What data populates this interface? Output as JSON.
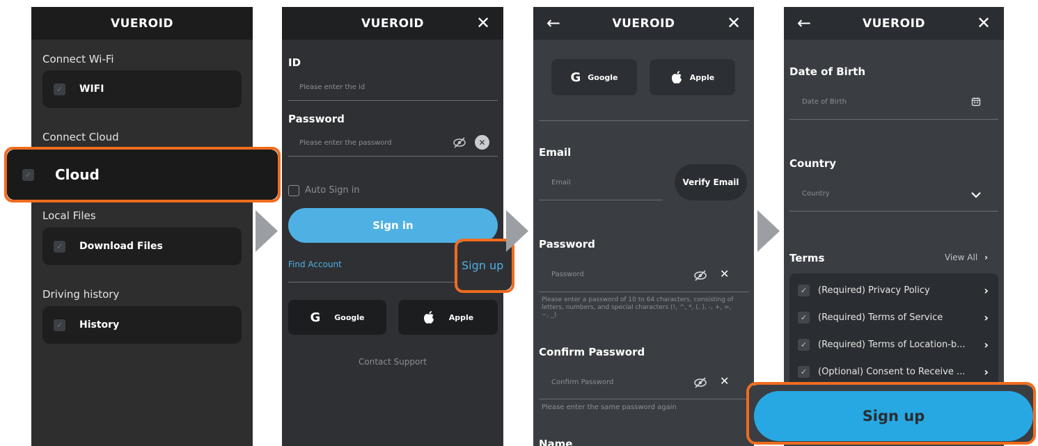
{
  "app": {
    "title": "VUEROID"
  },
  "screen1": {
    "sections": [
      {
        "label": "Connect Wi-Fi",
        "item": "WIFI"
      },
      {
        "label": "Connect Cloud",
        "item": "Cloud"
      },
      {
        "label": "Local Files",
        "item": "Download Files"
      },
      {
        "label": "Driving history",
        "item": "History"
      }
    ]
  },
  "screen2": {
    "id_label": "ID",
    "id_placeholder": "Please enter the id",
    "password_label": "Password",
    "password_placeholder": "Please enter the password",
    "auto_signin": "Auto Sign in",
    "signin_button": "Sign in",
    "find_account": "Find Account",
    "signup_link": "Sign up",
    "google": "Google",
    "apple": "Apple",
    "contact": "Contact Support"
  },
  "screen3": {
    "google": "Google",
    "apple": "Apple",
    "email_label": "Email",
    "email_placeholder": "Email",
    "verify_button": "Verify Email",
    "password_label": "Password",
    "password_placeholder": "Password",
    "password_hint": "Please enter a password of 10 to 64 characters, consisting of letters, numbers, and special characters (!, ^, *, (, ), -, +, =, ~, _)",
    "confirm_label": "Confirm Password",
    "confirm_placeholder": "Confirm Password",
    "confirm_hint": "Please enter the same password again",
    "name_label": "Name"
  },
  "screen4": {
    "dob_label": "Date of Birth",
    "dob_placeholder": "Date of Birth",
    "country_label": "Country",
    "country_placeholder": "Country",
    "terms_label": "Terms",
    "view_all": "View All",
    "terms": [
      "(Required) Privacy Policy",
      "(Required) Terms of Service",
      "(Required) Terms of Location-b...",
      "(Optional) Consent to Receive ..."
    ],
    "signup_button": "Sign up"
  },
  "colors": {
    "accent_blue": "#4fb0e3",
    "highlight_orange": "#ef6c1f",
    "bg_dark": "#2f3033",
    "bg_slate": "#3a3e43"
  }
}
